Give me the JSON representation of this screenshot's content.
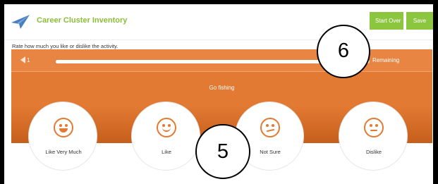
{
  "header": {
    "title": "Career Cluster Inventory",
    "start_over_label": "Start Over",
    "save_label": "Save",
    "logo_icon": "paper-plane-icon",
    "brand_color": "#8cc63f"
  },
  "instruction": "Rate how much you like or dislike the activity.",
  "progress": {
    "current": "1",
    "remaining_label": "Remaining",
    "fraction_complete": 0.96,
    "back_icon": "back-arrow-icon"
  },
  "activity": {
    "name": "Go fishing",
    "panel_color": "#e27a33"
  },
  "choices": [
    {
      "label": "Like Very Much",
      "icon": "very-happy-face-icon"
    },
    {
      "label": "Like",
      "icon": "happy-face-icon"
    },
    {
      "label": "Not Sure",
      "icon": "unsure-face-icon"
    },
    {
      "label": "Dislike",
      "icon": "sad-face-icon"
    }
  ],
  "callouts": [
    {
      "number": "6"
    },
    {
      "number": "5"
    }
  ]
}
